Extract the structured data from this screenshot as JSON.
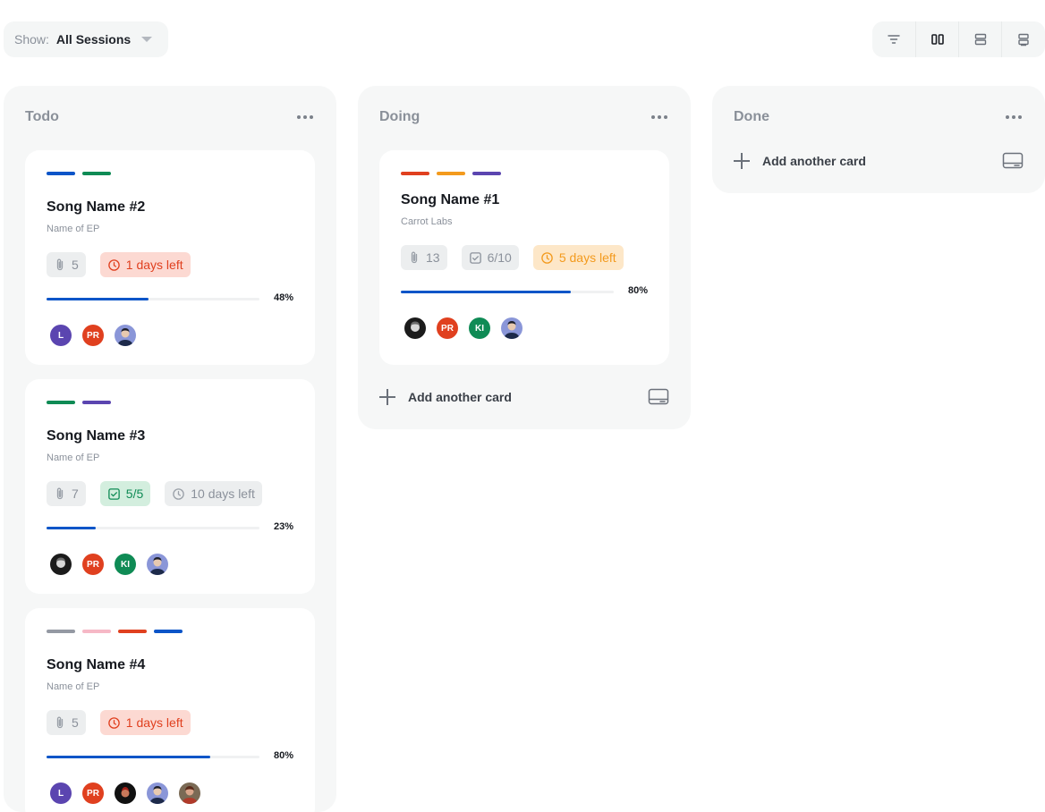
{
  "toolbar": {
    "show_label": "Show:",
    "show_value": "All Sessions",
    "view_buttons": [
      "filter-icon",
      "board-view-icon",
      "list-view-icon",
      "compact-view-icon"
    ]
  },
  "colors": {
    "blue": "#0b55c8",
    "green": "#0f8b55",
    "purple": "#5b45b0",
    "red": "#e0401f",
    "orange": "#f39a1d",
    "gray": "#9499a3",
    "pink": "#f6b8c6"
  },
  "columns": [
    {
      "title": "Todo",
      "cards": [
        {
          "tags": [
            "#0b55c8",
            "#0f8b55"
          ],
          "title": "Song Name #2",
          "subtitle": "Name of EP",
          "attachments": "5",
          "due": "1 days left",
          "due_style": "red",
          "progress": 48,
          "progress_label": "48%",
          "avatars": [
            {
              "initials": "L",
              "color": "#5b45b0"
            },
            {
              "initials": "PR",
              "color": "#e0401f"
            },
            {
              "initials": "",
              "kind": "photo-blue"
            }
          ]
        },
        {
          "tags": [
            "#0f8b55",
            "#5b45b0"
          ],
          "title": "Song Name #3",
          "subtitle": "Name of EP",
          "attachments": "7",
          "checklist": "5/5",
          "checklist_style": "green",
          "due": "10 days left",
          "due_style": "gray",
          "progress": 23,
          "progress_label": "23%",
          "avatars": [
            {
              "initials": "",
              "kind": "photo-dark"
            },
            {
              "initials": "PR",
              "color": "#e0401f"
            },
            {
              "initials": "KI",
              "color": "#0f8b55"
            },
            {
              "initials": "",
              "kind": "photo-blue"
            }
          ]
        },
        {
          "tags": [
            "#9499a3",
            "#f6b8c6",
            "#e0401f",
            "#0b55c8"
          ],
          "title": "Song Name #4",
          "subtitle": "Name of EP",
          "attachments": "5",
          "due": "1 days left",
          "due_style": "red",
          "progress": 77,
          "progress_label": "80%",
          "avatars": [
            {
              "initials": "L",
              "color": "#5b45b0"
            },
            {
              "initials": "PR",
              "color": "#e0401f"
            },
            {
              "initials": "",
              "kind": "photo-red"
            },
            {
              "initials": "",
              "kind": "photo-blue"
            },
            {
              "initials": "",
              "kind": "photo-brown"
            }
          ]
        }
      ]
    },
    {
      "title": "Doing",
      "cards": [
        {
          "tags": [
            "#e0401f",
            "#f39a1d",
            "#5b45b0"
          ],
          "title": "Song Name #1",
          "subtitle": "Carrot Labs",
          "attachments": "13",
          "checklist": "6/10",
          "checklist_style": "gray",
          "due": "5 days left",
          "due_style": "orange",
          "progress": 80,
          "progress_label": "80%",
          "avatars": [
            {
              "initials": "",
              "kind": "photo-dark"
            },
            {
              "initials": "PR",
              "color": "#e0401f"
            },
            {
              "initials": "KI",
              "color": "#0f8b55"
            },
            {
              "initials": "",
              "kind": "photo-blue"
            }
          ]
        }
      ],
      "add_label": "Add another card"
    },
    {
      "title": "Done",
      "cards": [],
      "add_label": "Add another card"
    }
  ]
}
